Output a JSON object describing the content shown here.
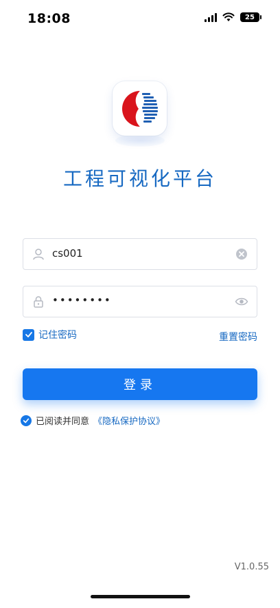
{
  "status_bar": {
    "time": "18:08",
    "battery": "25"
  },
  "app": {
    "title": "工程可视化平台"
  },
  "login_form": {
    "username_value": "cs001",
    "password_value": "••••••••",
    "remember_label": "记住密码",
    "reset_label": "重置密码",
    "login_button": "登录"
  },
  "agreement": {
    "text": "已阅读并同意",
    "link": "《隐私保护协议》"
  },
  "footer": {
    "version": "V1.0.55"
  },
  "colors": {
    "accent": "#1677f0",
    "title": "#1769c2",
    "logo_red": "#d9141c",
    "logo_blue": "#1f5fb3"
  }
}
